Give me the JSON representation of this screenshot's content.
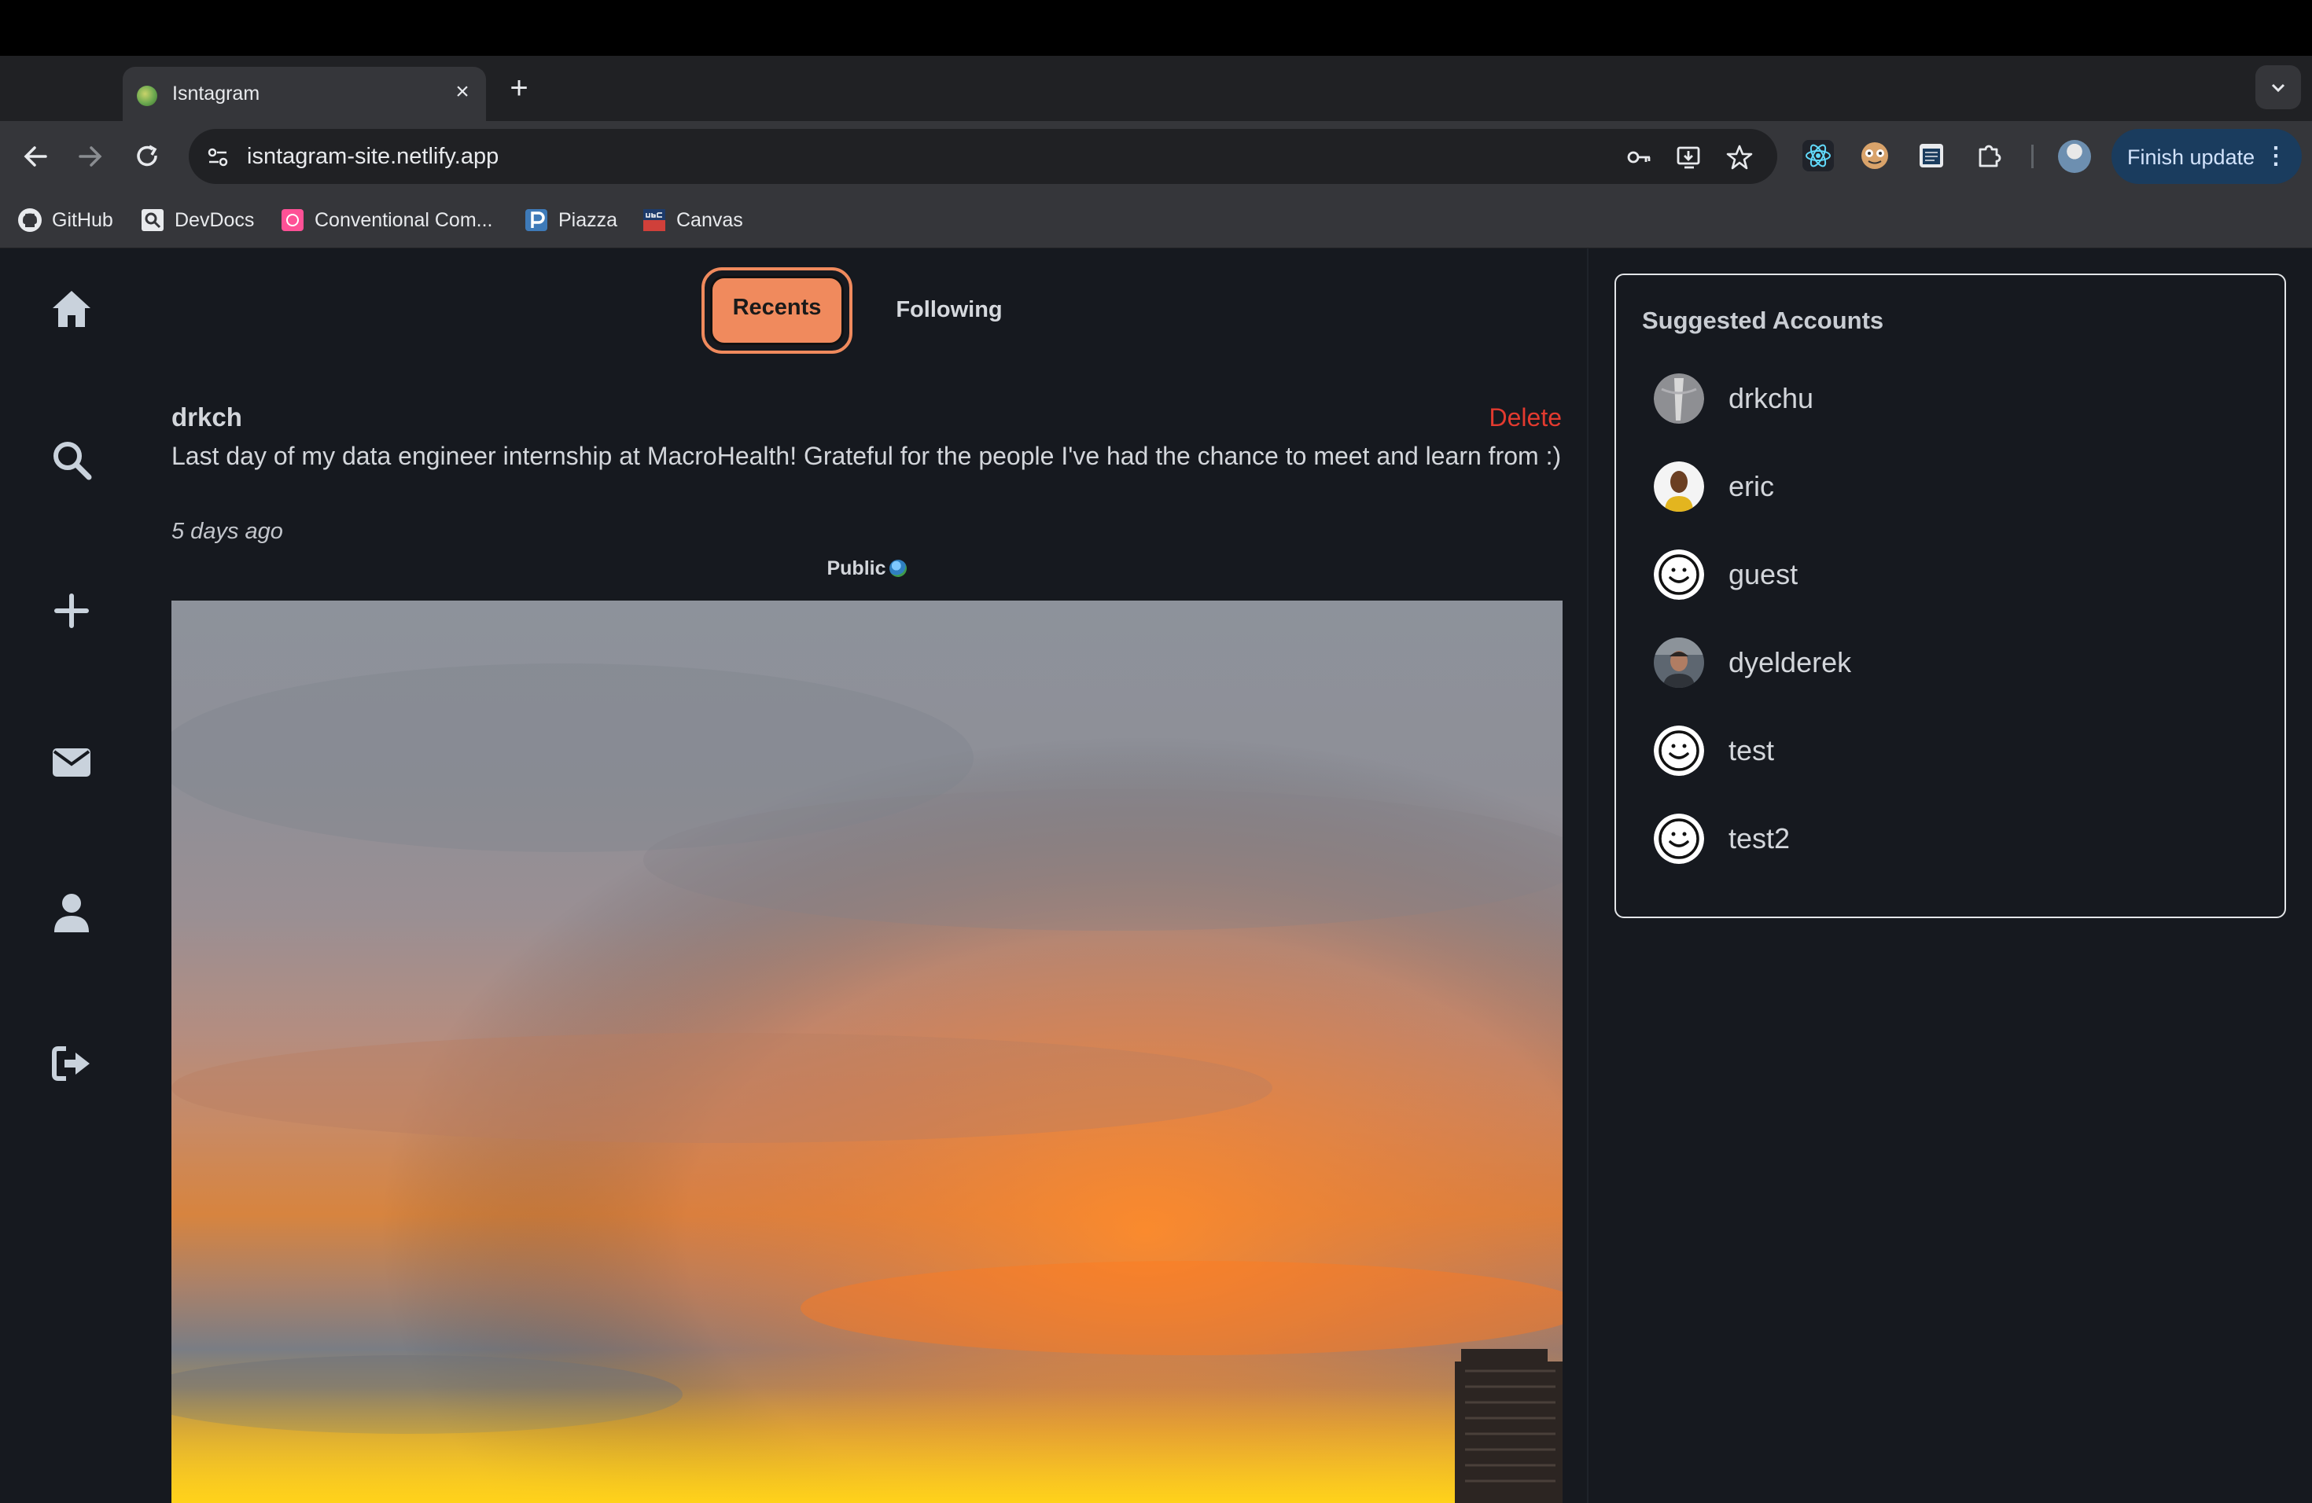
{
  "browser": {
    "tab_title": "Isntagram",
    "url": "isntagram-site.netlify.app",
    "finish_update_label": "Finish update",
    "bookmarks": [
      {
        "label": "GitHub",
        "icon": "github-icon"
      },
      {
        "label": "DevDocs",
        "icon": "devdocs-icon"
      },
      {
        "label": "Conventional Com...",
        "icon": "conventional-commits-icon"
      },
      {
        "label": "Piazza",
        "icon": "piazza-icon"
      },
      {
        "label": "Canvas",
        "icon": "canvas-icon"
      }
    ]
  },
  "sidebar": {
    "items": [
      {
        "name": "home",
        "icon": "home-icon"
      },
      {
        "name": "search",
        "icon": "search-icon"
      },
      {
        "name": "create",
        "icon": "plus-icon"
      },
      {
        "name": "messages",
        "icon": "envelope-icon"
      },
      {
        "name": "profile",
        "icon": "user-icon"
      },
      {
        "name": "logout",
        "icon": "sign-out-icon"
      }
    ]
  },
  "feed": {
    "tabs": {
      "recents": "Recents",
      "following": "Following"
    },
    "post": {
      "username": "drkch",
      "delete_label": "Delete",
      "text": "Last day of my data engineer internship at MacroHealth! Grateful for the people I've had the chance to meet and learn from :)",
      "time": "5 days ago",
      "visibility": "Public"
    }
  },
  "suggested": {
    "title": "Suggested Accounts",
    "accounts": [
      {
        "name": "drkchu",
        "avatar": "photo"
      },
      {
        "name": "eric",
        "avatar": "photo"
      },
      {
        "name": "guest",
        "avatar": "smiley"
      },
      {
        "name": "dyelderek",
        "avatar": "photo"
      },
      {
        "name": "test",
        "avatar": "smiley"
      },
      {
        "name": "test2",
        "avatar": "smiley"
      }
    ]
  },
  "colors": {
    "page_bg": "#16191f",
    "accent": "#f08a5d",
    "delete": "#e23a2f",
    "text": "#d3d6db"
  }
}
